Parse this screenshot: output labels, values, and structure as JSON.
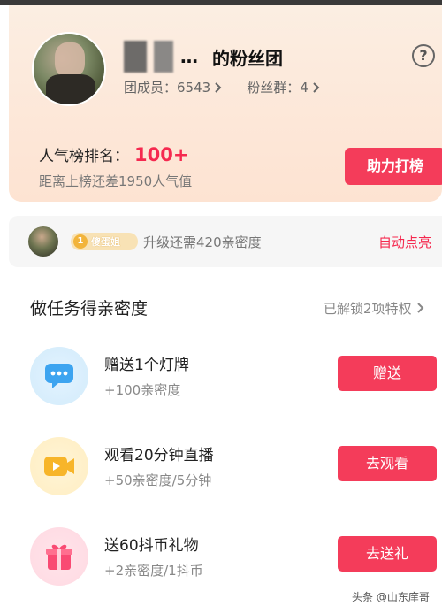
{
  "fan_group": {
    "name_suffix": "的粉丝团",
    "ellipsis": "…",
    "members_label": "团成员：6543",
    "groups_label": "粉丝群：4",
    "rank_label": "人气榜排名：",
    "rank_value": "100+",
    "gap_text": "距离上榜还差1950人气值",
    "help_button": "助力打榜",
    "help_icon": "?"
  },
  "level": {
    "badge_num": "1",
    "badge_label": "傻蛋姐",
    "upgrade_text": "升级还需420亲密度",
    "auto_light": "自动点亮"
  },
  "tasks_section": {
    "title": "做任务得亲密度",
    "unlock_link": "已解锁2项特权",
    "tasks": [
      {
        "title": "赠送1个灯牌",
        "sub": "+100亲密度",
        "button": "赠送",
        "icon": "chat-bubble-icon"
      },
      {
        "title": "观看20分钟直播",
        "sub": "+50亲密度/5分钟",
        "button": "去观看",
        "icon": "video-camera-icon"
      },
      {
        "title": "送60抖币礼物",
        "sub": "+2亲密度/1抖币",
        "button": "去送礼",
        "icon": "gift-icon"
      }
    ]
  },
  "watermark": "头条 @山东庠哥",
  "colors": {
    "accent": "#f43c5a",
    "rank": "#f5294f",
    "card_bg": "#fde7d8"
  }
}
